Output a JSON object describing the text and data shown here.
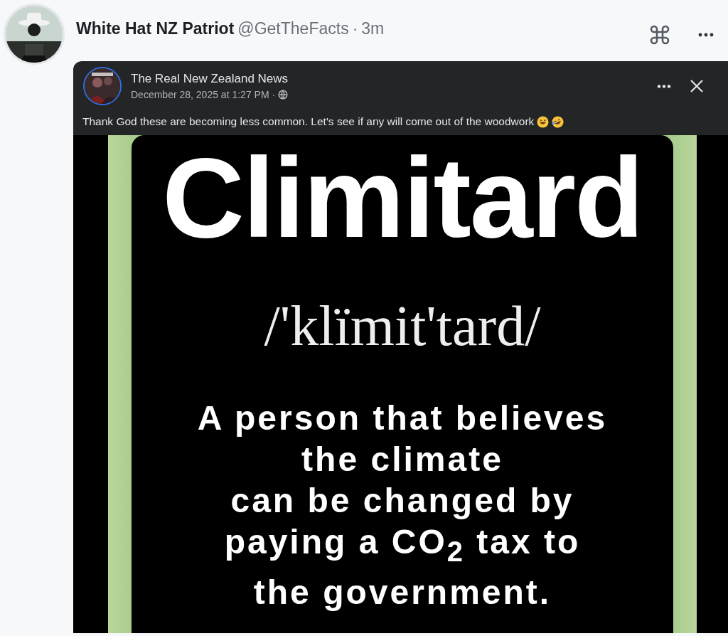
{
  "post": {
    "author": "White Hat NZ Patriot",
    "handle": "@GetTheFacts",
    "separator": "·",
    "time": "3m"
  },
  "shared_post": {
    "page_name": "The Real New Zealand News",
    "date": "December 28, 2025 at 1:27 PM",
    "separator": "·",
    "text": "Thank God these are becoming less common. Let's see if any will come out of the woodwork",
    "meme": {
      "headline": "Climitard",
      "pronunciation": "/'klïmit'tard/",
      "definition_lines": [
        "A person that believes",
        "the climate",
        "can be changed by",
        "paying a CO$_{2}$ tax to",
        "the government."
      ]
    }
  }
}
